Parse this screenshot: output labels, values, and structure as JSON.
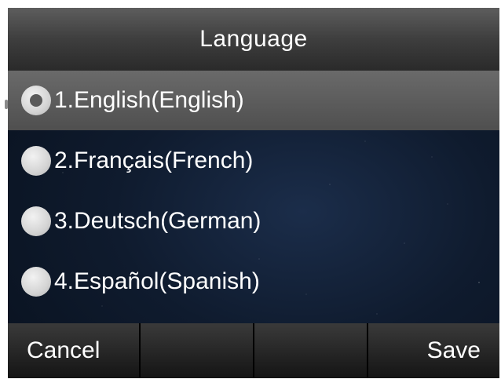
{
  "header": {
    "title": "Language"
  },
  "languages": {
    "items": [
      {
        "label": "1.English(English)",
        "selected": true
      },
      {
        "label": "2.Français(French)",
        "selected": false
      },
      {
        "label": "3.Deutsch(German)",
        "selected": false
      },
      {
        "label": "4.Español(Spanish)",
        "selected": false
      }
    ]
  },
  "softkeys": {
    "cancel_label": "Cancel",
    "key2_label": "",
    "key3_label": "",
    "save_label": "Save"
  },
  "colors": {
    "title_bar": "#3e3e3e",
    "selected_row": "#5a5a5a",
    "background": "#0f1b2e",
    "text": "#ffffff"
  }
}
